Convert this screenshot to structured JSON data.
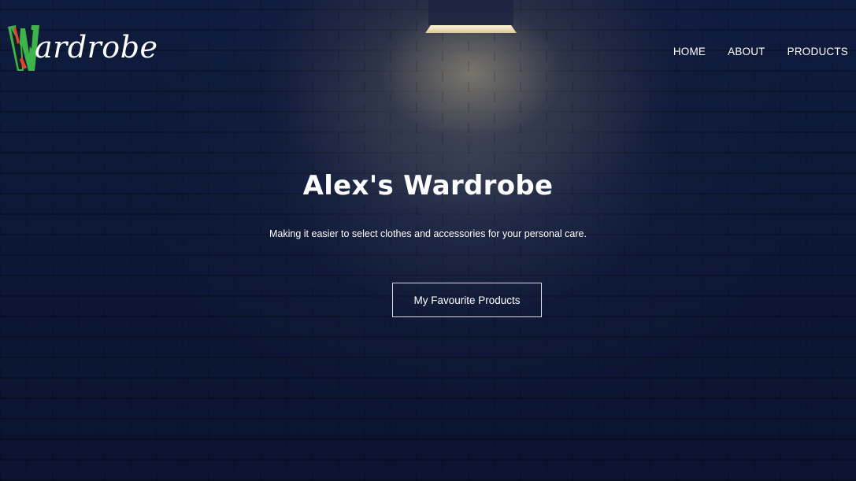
{
  "brand": {
    "logo_text": "ardrobe",
    "logo_initial": "W",
    "logo_colors": {
      "green": "#3cb44a",
      "red": "#e2432a",
      "dark": "#12202a"
    }
  },
  "nav": {
    "items": [
      {
        "label": "HOME"
      },
      {
        "label": "ABOUT"
      },
      {
        "label": "PRODUCTS"
      }
    ]
  },
  "hero": {
    "title": "Alex's Wardrobe",
    "subtitle": "Making it easier to select clothes and accessories for your personal care.",
    "cta_label": "My Favourite Products",
    "background": "brick-wall-with-spotlight",
    "accent_color": "#0c1735"
  }
}
